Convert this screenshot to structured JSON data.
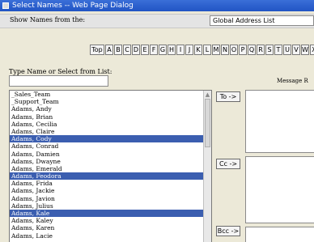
{
  "window": {
    "title": "Select Names -- Web Page Dialog"
  },
  "show_names": {
    "label": "Show Names from the:",
    "value": "Global Address List"
  },
  "alphabet": {
    "top_label": "Top",
    "letters": [
      "A",
      "B",
      "C",
      "D",
      "E",
      "F",
      "G",
      "H",
      "I",
      "J",
      "K",
      "L",
      "M",
      "N",
      "O",
      "P",
      "Q",
      "R",
      "S",
      "T",
      "U",
      "V",
      "W",
      "X"
    ]
  },
  "type_name": {
    "label": "Type Name or Select from List:",
    "value": ""
  },
  "message_label": "Message R",
  "names": [
    {
      "name": "_Sales_Team",
      "selected": false
    },
    {
      "name": "_Support_Team",
      "selected": false
    },
    {
      "name": "Adams, Andy",
      "selected": false
    },
    {
      "name": "Adams, Brian",
      "selected": false
    },
    {
      "name": "Adams, Cecilia",
      "selected": false
    },
    {
      "name": "Adams, Claire",
      "selected": false
    },
    {
      "name": "Adams, Cody",
      "selected": true
    },
    {
      "name": "Adams, Conrad",
      "selected": false
    },
    {
      "name": "Adams, Damien",
      "selected": false
    },
    {
      "name": "Adams, Dwayne",
      "selected": false
    },
    {
      "name": "Adams, Emerald",
      "selected": false
    },
    {
      "name": "Adams, Feodora",
      "selected": true
    },
    {
      "name": "Adams, Frida",
      "selected": false
    },
    {
      "name": "Adams, Jackie",
      "selected": false
    },
    {
      "name": "Adams, Javion",
      "selected": false
    },
    {
      "name": "Adams, Julius",
      "selected": false
    },
    {
      "name": "Adams, Kale",
      "selected": true
    },
    {
      "name": "Adams, Kaley",
      "selected": false
    },
    {
      "name": "Adams, Karen",
      "selected": false
    },
    {
      "name": "Adams, Lacie",
      "selected": false
    }
  ],
  "buttons": {
    "to": "To ->",
    "cc": "Cc ->",
    "bcc": "Bcc ->"
  },
  "colors": {
    "selection": "#3b5eb0",
    "titlebar": "#2154c4"
  }
}
